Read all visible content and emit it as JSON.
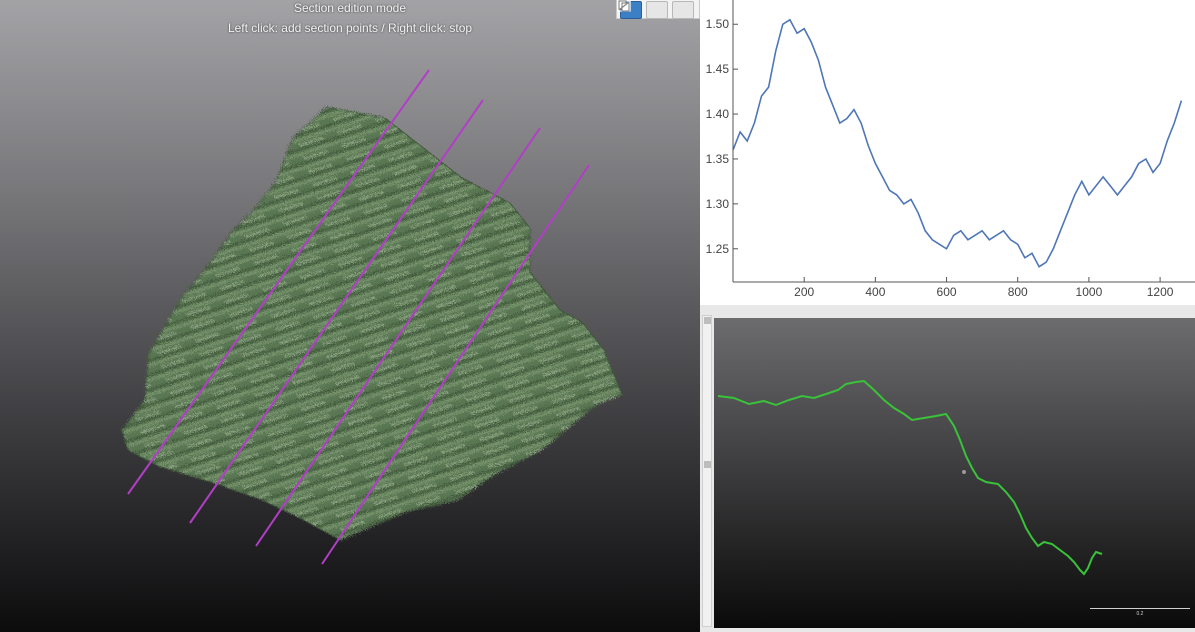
{
  "viewport": {
    "mode_title": "Section edition mode",
    "mode_help": "Left click: add section points / Right click: stop",
    "toolbar": [
      {
        "icon": "export-section-icon",
        "active": true
      },
      {
        "icon": "copy-icon",
        "active": false
      },
      {
        "icon": "edit-line-icon",
        "active": false
      }
    ],
    "section_line_color": "#b23ec8",
    "mesh_color": "#5d7a55"
  },
  "chart_data": {
    "type": "line",
    "x_ticks": [
      "200",
      "400",
      "600",
      "800",
      "1000",
      "1200"
    ],
    "y_ticks": [
      "1.25",
      "1.30",
      "1.35",
      "1.40",
      "1.45",
      "1.50"
    ],
    "xlim": [
      0,
      1270
    ],
    "ylim": [
      1.213,
      1.527
    ],
    "color": "#4f76b8",
    "grid": false,
    "series": [
      {
        "x": [
          0,
          20,
          40,
          60,
          80,
          100,
          120,
          140,
          160,
          180,
          200,
          220,
          240,
          260,
          280,
          300,
          320,
          340,
          360,
          380,
          400,
          420,
          440,
          460,
          480,
          500,
          520,
          540,
          560,
          580,
          600,
          620,
          640,
          660,
          680,
          700,
          720,
          740,
          760,
          780,
          800,
          820,
          840,
          860,
          880,
          900,
          920,
          940,
          960,
          980,
          1000,
          1020,
          1040,
          1060,
          1080,
          1100,
          1120,
          1140,
          1160,
          1180,
          1200,
          1220,
          1240,
          1260
        ],
        "y": [
          1.36,
          1.38,
          1.37,
          1.39,
          1.42,
          1.43,
          1.47,
          1.5,
          1.505,
          1.49,
          1.495,
          1.48,
          1.46,
          1.43,
          1.41,
          1.39,
          1.395,
          1.405,
          1.39,
          1.365,
          1.345,
          1.33,
          1.315,
          1.31,
          1.3,
          1.305,
          1.29,
          1.27,
          1.26,
          1.255,
          1.25,
          1.265,
          1.27,
          1.26,
          1.265,
          1.27,
          1.26,
          1.265,
          1.27,
          1.26,
          1.255,
          1.24,
          1.245,
          1.23,
          1.235,
          1.25,
          1.27,
          1.29,
          1.31,
          1.325,
          1.31,
          1.32,
          1.33,
          1.32,
          1.31,
          1.32,
          1.33,
          1.345,
          1.35,
          1.335,
          1.345,
          1.37,
          1.39,
          1.415
        ]
      }
    ]
  },
  "section_view": {
    "profile_color": "#39c23a",
    "scale_label": "0.2"
  }
}
